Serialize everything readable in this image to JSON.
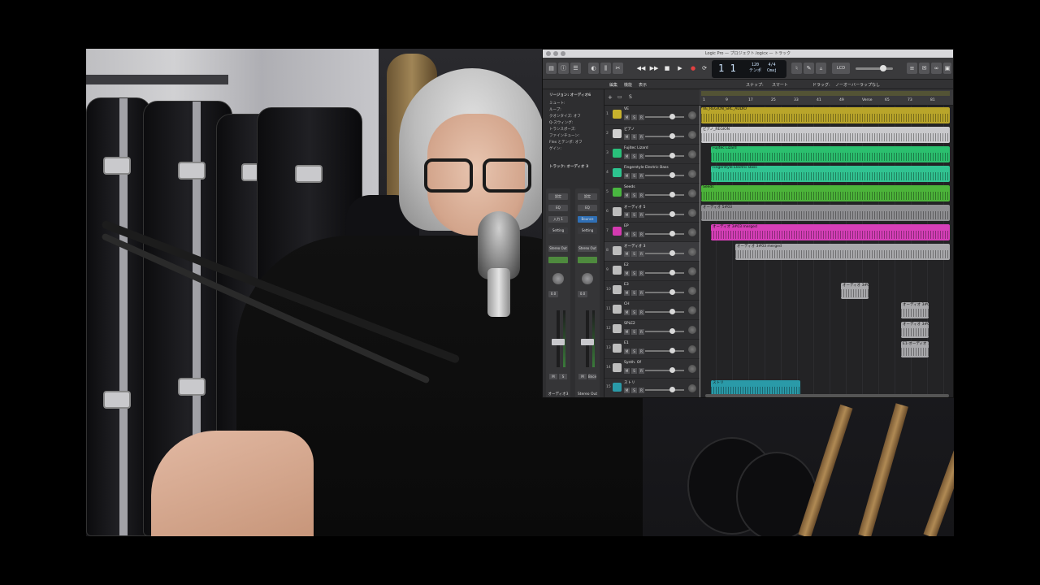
{
  "window": {
    "title": "Logic Pro — プロジェクト.logicx — トラック"
  },
  "lcd": {
    "bar": "1 1",
    "tempo_value": "120",
    "tempo_label": "テンポ",
    "signature": "4/4",
    "key": "Cmaj"
  },
  "toolbar": {
    "zoom_label": "LCD"
  },
  "menubar": {
    "items": [
      "編集",
      "機能",
      "表示",
      "スナップ:",
      "スマート",
      "ドラッグ:",
      "ノーオーバーラップなし"
    ]
  },
  "inspector": {
    "header": "リージョン: オーディオ6",
    "rows": [
      "ミュート:",
      "ループ:",
      "クオンタイズ: オフ",
      "Q-スウィング:",
      "トランスポーズ:",
      "ファインチューン:",
      "Flex とテンポ: オフ",
      "ゲイン:"
    ],
    "track_header": "トラック: オーディオ 3",
    "strip_left": {
      "slots": [
        "設定",
        "EQ",
        "入力 1",
        "Setting"
      ],
      "sends": "Stereo Out",
      "readout": "0.0",
      "label": "オーディオ3"
    },
    "strip_right": {
      "slots": [
        "設定",
        "EQ",
        "Bounce",
        "Setting"
      ],
      "sends": "Stereo Out",
      "readout": "0.0",
      "label": "Stereo Out"
    },
    "mute": "M",
    "solo": "S",
    "bounce": "Bnce"
  },
  "track_buttons": {
    "mute": "M",
    "solo": "S",
    "record": "R"
  },
  "tracks": [
    {
      "num": "1",
      "name": "VE",
      "color": "#c8b22d"
    },
    {
      "num": "2",
      "name": "ピアノ",
      "color": "#d0d0d0"
    },
    {
      "num": "3",
      "name": "Fujitec Lizard",
      "color": "#29c07a"
    },
    {
      "num": "4",
      "name": "Fingerstyle Electric Bass",
      "color": "#2dc48f"
    },
    {
      "num": "5",
      "name": "Seeds",
      "color": "#49b640"
    },
    {
      "num": "6",
      "name": "オーディオ 5",
      "color": "#bdbdbd"
    },
    {
      "num": "7",
      "name": "EP",
      "color": "#d43ab0"
    },
    {
      "num": "8",
      "name": "オーディオ 3",
      "color": "#bdbdbd"
    },
    {
      "num": "9",
      "name": "E2",
      "color": "#bdbdbd"
    },
    {
      "num": "10",
      "name": "E3",
      "color": "#bdbdbd"
    },
    {
      "num": "11",
      "name": "CH",
      "color": "#bdbdbd"
    },
    {
      "num": "12",
      "name": "SPLE2",
      "color": "#bdbdbd"
    },
    {
      "num": "13",
      "name": "E1",
      "color": "#bdbdbd"
    },
    {
      "num": "14",
      "name": "Synth. Of",
      "color": "#bdbdbd"
    },
    {
      "num": "15",
      "name": "ストリ",
      "color": "#2a9aa8"
    }
  ],
  "ruler": {
    "marks": [
      "1",
      "9",
      "17",
      "25",
      "33",
      "41",
      "49",
      "Verse",
      "65",
      "73",
      "81"
    ]
  },
  "regions": [
    {
      "name": "VE_REGION_SRC_AUDIO",
      "color": "#b9a52a"
    },
    {
      "name": "ピアノ_REGION",
      "color": "#c9c9cc"
    },
    {
      "name": "Fujitec Lizard",
      "color": "#2bbf6e"
    },
    {
      "name": "Fingerstyle Electric Bass",
      "color": "#31c391"
    },
    {
      "name": "Seeds",
      "color": "#4cb43a"
    },
    {
      "name": "オーディオ 5#03",
      "color": "#8f8f92"
    },
    {
      "name": "オーディオ 3#03 merged",
      "color": "#d63fb8"
    },
    {
      "name": "オーディオ 3#03 merged",
      "color": "#a9a9ac"
    },
    {
      "name": "オーディオ 3#04",
      "color": "#a9a9ac"
    },
    {
      "name": "オーディオ 3#02",
      "color": "#a9a9ac"
    },
    {
      "name": "オーディオ 3#05",
      "color": "#a9a9ac"
    },
    {
      "name": "E1-オーディオ 3#",
      "color": "#a9a9ac"
    },
    {
      "name": "ストリ",
      "color": "#2a9aa8"
    }
  ]
}
